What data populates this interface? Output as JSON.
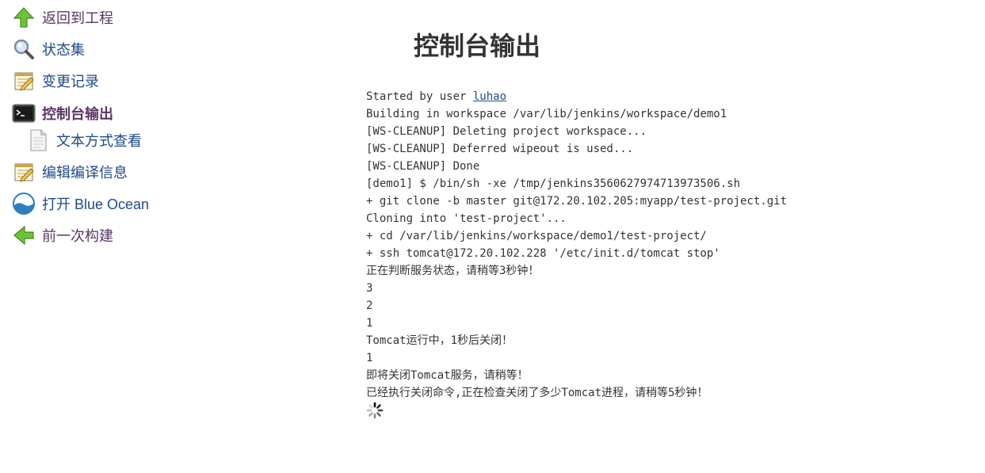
{
  "sidebar": {
    "items": [
      {
        "label": "返回到工程",
        "icon": "up-arrow-icon"
      },
      {
        "label": "状态集",
        "icon": "magnifier-icon"
      },
      {
        "label": "变更记录",
        "icon": "notepad-icon"
      },
      {
        "label": "控制台输出",
        "icon": "terminal-icon"
      },
      {
        "label": "文本方式查看",
        "icon": "document-icon"
      },
      {
        "label": "编辑编译信息",
        "icon": "notepad-icon"
      },
      {
        "label": "打开 Blue Ocean",
        "icon": "blue-ocean-icon"
      },
      {
        "label": "前一次构建",
        "icon": "left-arrow-icon"
      }
    ]
  },
  "main": {
    "title": "控制台输出",
    "console": {
      "first_line_prefix": "Started by user ",
      "user": "luhao",
      "lines": [
        "Building in workspace /var/lib/jenkins/workspace/demo1",
        "[WS-CLEANUP] Deleting project workspace...",
        "[WS-CLEANUP] Deferred wipeout is used...",
        "[WS-CLEANUP] Done",
        "[demo1] $ /bin/sh -xe /tmp/jenkins3560627974713973506.sh",
        "+ git clone -b master git@172.20.102.205:myapp/test-project.git",
        "Cloning into 'test-project'...",
        "+ cd /var/lib/jenkins/workspace/demo1/test-project/",
        "+ ssh tomcat@172.20.102.228 '/etc/init.d/tomcat stop'",
        "正在判断服务状态，请稍等3秒钟！",
        "3",
        "2",
        "1",
        "Tomcat运行中，1秒后关闭！",
        "1",
        "即将关闭Tomcat服务，请稍等！",
        "已经执行关闭命令,正在检查关闭了多少Tomcat进程，请稍等5秒钟！"
      ]
    },
    "spinner": "loading-spinner-icon"
  },
  "colors": {
    "link": "#204a87",
    "visited": "#5c3566",
    "text": "#333333"
  }
}
